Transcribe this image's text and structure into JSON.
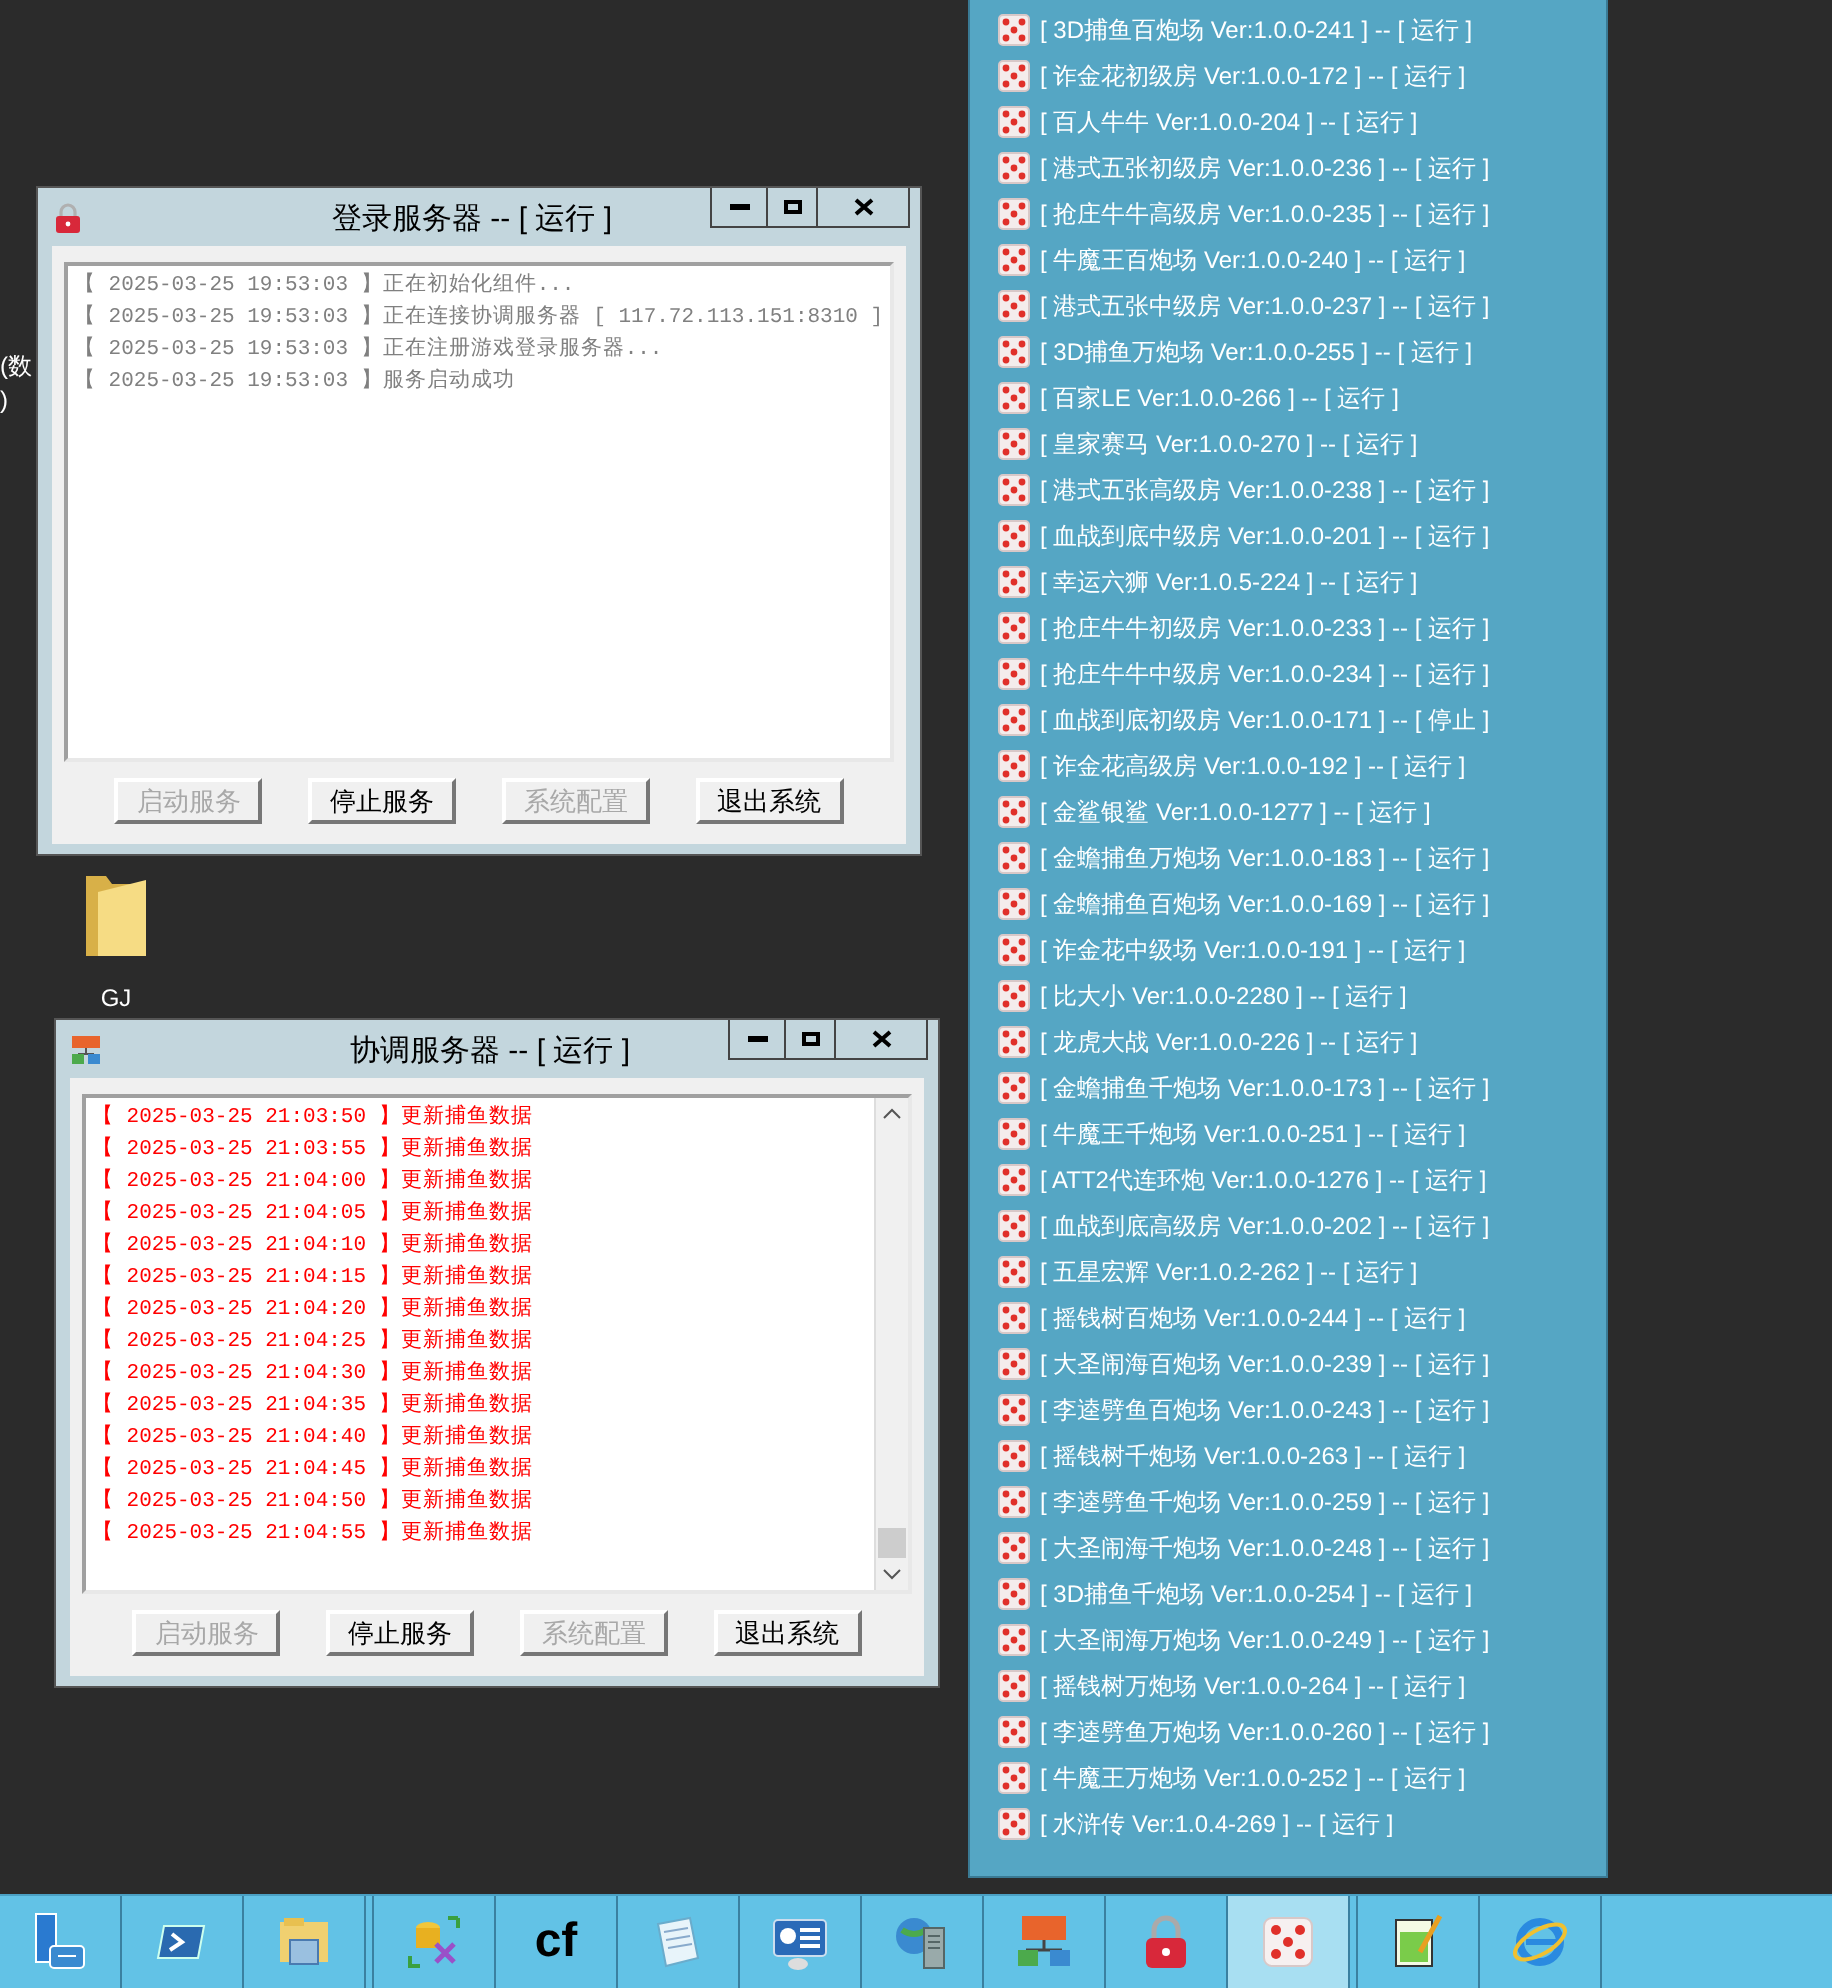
{
  "desktop": {
    "edge_texts": [
      "(数",
      ")"
    ],
    "icons": [
      {
        "label": "GJ"
      }
    ]
  },
  "windows": [
    {
      "kind": "login",
      "title": "登录服务器 -- [ 运行 ]",
      "color": "#808080",
      "log": [
        "【 2025-03-25 19:53:03 】正在初始化组件...",
        "【 2025-03-25 19:53:03 】正在连接协调服务器 [ 117.72.113.151:8310 ]",
        "【 2025-03-25 19:53:03 】正在注册游戏登录服务器...",
        "【 2025-03-25 19:53:03 】服务启动成功"
      ],
      "buttons": [
        {
          "label": "启动服务",
          "disabled": true
        },
        {
          "label": "停止服务",
          "disabled": false
        },
        {
          "label": "系统配置",
          "disabled": true
        },
        {
          "label": "退出系统",
          "disabled": false
        }
      ]
    },
    {
      "kind": "coordinator",
      "title": "协调服务器 -- [ 运行 ]",
      "color": "#ff0000",
      "log": [
        "【 2025-03-25 21:03:50 】更新捕鱼数据",
        "【 2025-03-25 21:03:55 】更新捕鱼数据",
        "【 2025-03-25 21:04:00 】更新捕鱼数据",
        "【 2025-03-25 21:04:05 】更新捕鱼数据",
        "【 2025-03-25 21:04:10 】更新捕鱼数据",
        "【 2025-03-25 21:04:15 】更新捕鱼数据",
        "【 2025-03-25 21:04:20 】更新捕鱼数据",
        "【 2025-03-25 21:04:25 】更新捕鱼数据",
        "【 2025-03-25 21:04:30 】更新捕鱼数据",
        "【 2025-03-25 21:04:35 】更新捕鱼数据",
        "【 2025-03-25 21:04:40 】更新捕鱼数据",
        "【 2025-03-25 21:04:45 】更新捕鱼数据",
        "【 2025-03-25 21:04:50 】更新捕鱼数据",
        "【 2025-03-25 21:04:55 】更新捕鱼数据"
      ],
      "buttons": [
        {
          "label": "启动服务",
          "disabled": true
        },
        {
          "label": "停止服务",
          "disabled": false
        },
        {
          "label": "系统配置",
          "disabled": true
        },
        {
          "label": "退出系统",
          "disabled": false
        }
      ]
    }
  ],
  "services": [
    "[ 3D捕鱼百炮场 Ver:1.0.0-241 ] -- [ 运行 ]",
    "[ 诈金花初级房 Ver:1.0.0-172 ] -- [ 运行 ]",
    "[ 百人牛牛 Ver:1.0.0-204 ] -- [ 运行 ]",
    "[ 港式五张初级房 Ver:1.0.0-236 ] -- [ 运行 ]",
    "[ 抢庄牛牛高级房 Ver:1.0.0-235 ] -- [ 运行 ]",
    "[ 牛魔王百炮场 Ver:1.0.0-240 ] -- [ 运行 ]",
    "[ 港式五张中级房 Ver:1.0.0-237 ] -- [ 运行 ]",
    "[ 3D捕鱼万炮场 Ver:1.0.0-255 ] -- [ 运行 ]",
    "[ 百家LE Ver:1.0.0-266 ] -- [ 运行 ]",
    "[ 皇家赛马 Ver:1.0.0-270 ] -- [ 运行 ]",
    "[ 港式五张高级房 Ver:1.0.0-238 ] -- [ 运行 ]",
    "[ 血战到底中级房 Ver:1.0.0-201 ] -- [ 运行 ]",
    "[ 幸运六狮 Ver:1.0.5-224 ] -- [ 运行 ]",
    "[ 抢庄牛牛初级房 Ver:1.0.0-233 ] -- [ 运行 ]",
    "[ 抢庄牛牛中级房 Ver:1.0.0-234 ] -- [ 运行 ]",
    "[ 血战到底初级房 Ver:1.0.0-171 ] -- [ 停止 ]",
    "[ 诈金花高级房 Ver:1.0.0-192 ] -- [ 运行 ]",
    "[ 金鲨银鲨 Ver:1.0.0-1277 ] -- [ 运行 ]",
    "[ 金蟾捕鱼万炮场 Ver:1.0.0-183 ] -- [ 运行 ]",
    "[ 金蟾捕鱼百炮场 Ver:1.0.0-169 ] -- [ 运行 ]",
    "[ 诈金花中级场 Ver:1.0.0-191 ] -- [ 运行 ]",
    "[ 比大小 Ver:1.0.0-2280 ] -- [ 运行 ]",
    "[ 龙虎大战 Ver:1.0.0-226 ] -- [ 运行 ]",
    "[ 金蟾捕鱼千炮场 Ver:1.0.0-173 ] -- [ 运行 ]",
    "[ 牛魔王千炮场 Ver:1.0.0-251 ] -- [ 运行 ]",
    "[ ATT2代连环炮 Ver:1.0.0-1276 ] -- [ 运行 ]",
    "[ 血战到底高级房 Ver:1.0.0-202 ] -- [ 运行 ]",
    "[ 五星宏辉 Ver:1.0.2-262 ] -- [ 运行 ]",
    "[ 摇钱树百炮场 Ver:1.0.0-244 ] -- [ 运行 ]",
    "[ 大圣闹海百炮场 Ver:1.0.0-239 ] -- [ 运行 ]",
    "[ 李逵劈鱼百炮场 Ver:1.0.0-243 ] -- [ 运行 ]",
    "[ 摇钱树千炮场 Ver:1.0.0-263 ] -- [ 运行 ]",
    "[ 李逵劈鱼千炮场 Ver:1.0.0-259 ] -- [ 运行 ]",
    "[ 大圣闹海千炮场 Ver:1.0.0-248 ] -- [ 运行 ]",
    "[ 3D捕鱼千炮场 Ver:1.0.0-254 ] -- [ 运行 ]",
    "[ 大圣闹海万炮场 Ver:1.0.0-249 ] -- [ 运行 ]",
    "[ 摇钱树万炮场 Ver:1.0.0-264 ] -- [ 运行 ]",
    "[ 李逵劈鱼万炮场 Ver:1.0.0-260 ] -- [ 运行 ]",
    "[ 牛魔王万炮场 Ver:1.0.0-252 ] -- [ 运行 ]",
    "[ 水浒传 Ver:1.0.4-269 ] -- [ 运行 ]"
  ],
  "taskbar": [
    {
      "kind": "server",
      "selected": false
    },
    {
      "kind": "shell",
      "selected": false
    },
    {
      "kind": "explorer",
      "selected": false
    },
    {
      "kind": "tools",
      "selected": false
    },
    {
      "kind": "text",
      "label": "cf",
      "selected": false
    },
    {
      "kind": "notepad",
      "selected": false
    },
    {
      "kind": "panel",
      "selected": false
    },
    {
      "kind": "globe-server",
      "selected": false
    },
    {
      "kind": "network",
      "selected": false
    },
    {
      "kind": "lock",
      "selected": false
    },
    {
      "kind": "dice",
      "selected": true
    },
    {
      "kind": "editor",
      "selected": false
    },
    {
      "kind": "browser",
      "selected": false
    }
  ]
}
